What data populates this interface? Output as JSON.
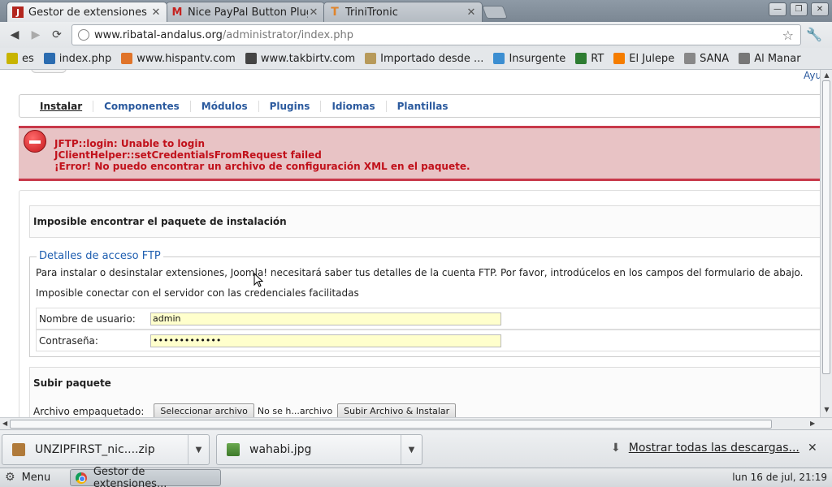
{
  "browser": {
    "tabs": [
      {
        "title": "Gestor de extensiones :",
        "active": true
      },
      {
        "title": "Nice PayPal Button Plugi",
        "active": false
      },
      {
        "title": "TriniTronic",
        "active": false
      }
    ],
    "url_host": "www.ribatal-andalus.org",
    "url_path": "/administrator/index.php",
    "bookmarks": [
      {
        "label": "es",
        "icon": "v-icon",
        "color": "#c8b400"
      },
      {
        "label": "index.php",
        "icon": "globe-icon",
        "color": "#2b6cb0"
      },
      {
        "label": "www.hispantv.com",
        "icon": "hispantv-icon",
        "color": "#e0742a"
      },
      {
        "label": "www.takbirtv.com",
        "icon": "takbirtv-icon",
        "color": "#444444"
      },
      {
        "label": "Importado desde ...",
        "icon": "folder-icon",
        "color": "#b79a5a"
      },
      {
        "label": "Insurgente",
        "icon": "insurgente-icon",
        "color": "#3c8ed1"
      },
      {
        "label": "RT",
        "icon": "rt-icon",
        "color": "#2e7d32"
      },
      {
        "label": "El Julepe",
        "icon": "blogger-icon",
        "color": "#f57d00"
      },
      {
        "label": "SANA",
        "icon": "document-icon",
        "color": "#888888"
      },
      {
        "label": "Al Manar",
        "icon": "almanar-icon",
        "color": "#777777"
      }
    ]
  },
  "page": {
    "help_link": "Ayu",
    "submenu": [
      "Instalar",
      "Componentes",
      "Módulos",
      "Plugins",
      "Idiomas",
      "Plantillas"
    ],
    "active_submenu": "Instalar",
    "errors": [
      "JFTP::login: Unable to login",
      "JClientHelper::setCredentialsFromRequest failed",
      "¡Error! No puedo encontrar un archivo de configuración XML en el paquete."
    ],
    "panel_title": "Imposible encontrar el paquete de instalación",
    "ftp": {
      "legend": "Detalles de acceso FTP",
      "intro": "Para instalar o desinstalar extensiones, Joomla! necesitará saber tus detalles de la cuenta FTP. Por favor, introdúcelos en los campos del formulario de abajo.",
      "status": "Imposible conectar con el servidor con las credenciales facilitadas",
      "username_label": "Nombre de usuario:",
      "username_value": "admin",
      "password_label": "Contraseña:",
      "password_value": "•••••••••••••"
    },
    "upload": {
      "title": "Subir paquete",
      "file_label": "Archivo empaquetado:",
      "select_button": "Seleccionar archivo",
      "no_file_text": "No se h...archivo",
      "submit_button": "Subir Archivo & Instalar"
    }
  },
  "downloads": {
    "items": [
      "UNZIPFIRST_nic....zip",
      "wahabi.jpg"
    ],
    "show_all": "Mostrar todas las descargas..."
  },
  "taskbar": {
    "menu_label": "Menu",
    "window_label": "Gestor de extensiones...",
    "clock": "lun 16 de jul, 21:19"
  }
}
